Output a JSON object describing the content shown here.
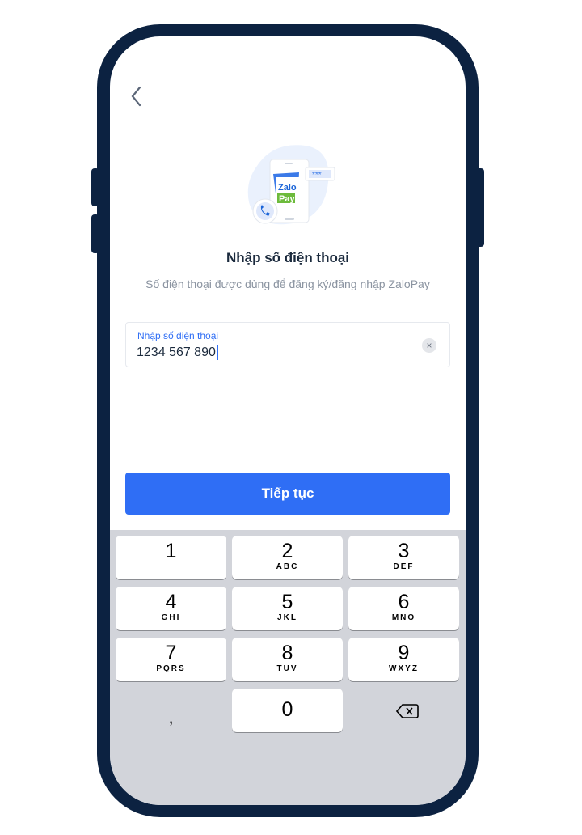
{
  "header": {
    "back_icon": "chevron-left-icon"
  },
  "illustration": {
    "logo_text_1": "Zalo",
    "logo_text_2": "Pay",
    "password_dots": "***"
  },
  "title": "Nhập số điện thoại",
  "subtitle": "Số điện thoại được dùng để đăng ký/đăng nhập ZaloPay",
  "phone_field": {
    "label": "Nhập số điện thoại",
    "value": "1234 567 890",
    "clear_icon": "×"
  },
  "continue_button": "Tiếp tục",
  "keypad": {
    "keys": [
      {
        "n": "1",
        "l": ""
      },
      {
        "n": "2",
        "l": "ABC"
      },
      {
        "n": "3",
        "l": "DEF"
      },
      {
        "n": "4",
        "l": "GHI"
      },
      {
        "n": "5",
        "l": "JKL"
      },
      {
        "n": "6",
        "l": "MNO"
      },
      {
        "n": "7",
        "l": "PQRS"
      },
      {
        "n": "8",
        "l": "TUV"
      },
      {
        "n": "9",
        "l": "WXYZ"
      }
    ],
    "comma": ",",
    "zero": "0"
  },
  "colors": {
    "accent": "#2f6ef5",
    "frame": "#0c2241"
  }
}
